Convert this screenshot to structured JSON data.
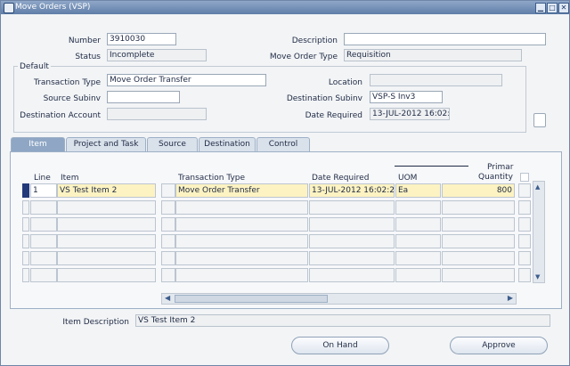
{
  "window": {
    "title": "Move Orders (VSP)",
    "buttons": {
      "min": "▁",
      "max": "□",
      "close": "✕"
    }
  },
  "header": {
    "number_label": "Number",
    "number_value": "3910030",
    "description_label": "Description",
    "description_value": "",
    "status_label": "Status",
    "status_value": "Incomplete",
    "move_order_type_label": "Move Order Type",
    "move_order_type_value": "Requisition"
  },
  "default": {
    "group_label": "Default",
    "transaction_type_label": "Transaction Type",
    "transaction_type_value": "Move Order Transfer",
    "location_label": "Location",
    "location_value": "",
    "source_subinv_label": "Source Subinv",
    "source_subinv_value": "",
    "destination_subinv_label": "Destination Subinv",
    "destination_subinv_value": "VSP-S Inv3",
    "destination_account_label": "Destination Account",
    "destination_account_value": "",
    "date_required_label": "Date Required",
    "date_required_value": "13-JUL-2012 16:02:"
  },
  "tabs": [
    "Item",
    "Project and Task",
    "Source",
    "Destination",
    "Control"
  ],
  "lines": {
    "columns": {
      "line": "Line",
      "item": "Item",
      "transaction_type": "Transaction Type",
      "date_required": "Date Required",
      "uom": "UOM",
      "primary_quantity_1": "Primar",
      "primary_quantity_2": "Quantity"
    },
    "rows": [
      {
        "line": "1",
        "item": "VS Test Item 2",
        "transaction_type": "Move Order Transfer",
        "date_required": "13-JUL-2012 16:02:2!",
        "uom": "Ea",
        "quantity": "800"
      }
    ]
  },
  "footer": {
    "item_description_label": "Item Description",
    "item_description_value": "VS Test Item 2"
  },
  "actions": {
    "on_hand": "On Hand",
    "approve": "Approve"
  }
}
